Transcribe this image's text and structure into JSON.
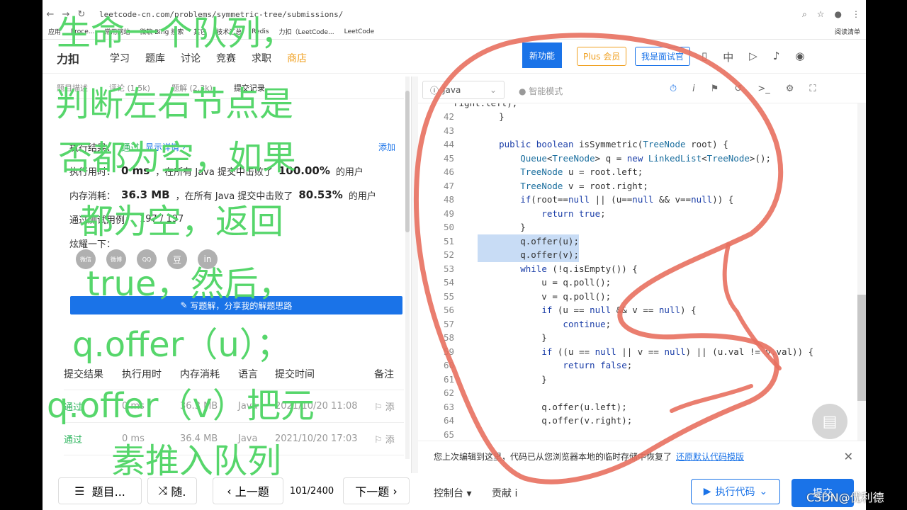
{
  "browser": {
    "url": "leetcode-cn.com/problems/symmetric-tree/submissions/",
    "bookmarks": [
      "应用",
      "Proce...",
      "常用网站",
      "微软 Bing 搜索",
      "其它",
      "技术汇总",
      "Redis",
      "力扣（LeetCode...",
      "LeetCode"
    ],
    "reader_mode": "阅读清单"
  },
  "header": {
    "logo": "力扣",
    "menu": [
      "学习",
      "题库",
      "讨论",
      "竞赛",
      "求职",
      "商店"
    ],
    "new_feature": "新功能",
    "plus": "Plus 会员",
    "interviewer": "我是面试官",
    "language": "中"
  },
  "left": {
    "tabs": [
      "题目描述",
      "评论 (1.5k)",
      "题解 (2.3k)",
      "提交记录"
    ],
    "exec_result_label": "执行结果：",
    "exec_result_value": "通过",
    "show_detail": "显示详情 ›",
    "add_note": "添加",
    "exec_time_label": "执行用时：",
    "exec_time_value": "0 ms",
    "exec_time_desc": "，在所有 Java 提交中击败了",
    "exec_time_pct": "100.00%",
    "users_label": "的用户",
    "mem_label": "内存消耗：",
    "mem_value": "36.3 MB",
    "mem_desc": "，在所有 Java 提交中击败了",
    "mem_pct": "80.53%",
    "cases_label": "通过测试用例：",
    "cases_value": "197 / 197",
    "share_label": "炫耀一下：",
    "share_icons": [
      "微信",
      "微博",
      "QQ",
      "豆",
      "in"
    ],
    "write_solution": "写题解，分享我的解题思路",
    "table_headers": [
      "提交结果",
      "执行用时",
      "内存消耗",
      "语言",
      "提交时间",
      "备注"
    ],
    "rows": [
      {
        "result": "通过",
        "time": "0 ms",
        "mem": "36.3 MB",
        "lang": "Java",
        "date": "2021/10/20 11:08",
        "note": "添"
      },
      {
        "result": "通过",
        "time": "0 ms",
        "mem": "36.4 MB",
        "lang": "Java",
        "date": "2021/10/20 17:03",
        "note": "添"
      }
    ]
  },
  "bottom_nav": {
    "list": "题目...",
    "random": "随.",
    "prev": "上一题",
    "progress": "101/2400",
    "next": "下一题"
  },
  "editor": {
    "language": "Java",
    "smart_mode": "智能模式",
    "lines": [
      {
        "n": "42",
        "t": "    }"
      },
      {
        "n": "43",
        "t": ""
      },
      {
        "n": "44",
        "t": "    public boolean isSymmetric(TreeNode root) {"
      },
      {
        "n": "45",
        "t": "        Queue<TreeNode> q = new LinkedList<TreeNode>();"
      },
      {
        "n": "46",
        "t": "        TreeNode u = root.left;"
      },
      {
        "n": "47",
        "t": "        TreeNode v = root.right;"
      },
      {
        "n": "48",
        "t": "        if(root==null || (u==null && v==null)) {"
      },
      {
        "n": "49",
        "t": "            return true;"
      },
      {
        "n": "50",
        "t": "        }"
      },
      {
        "n": "51",
        "t": "        q.offer(u);"
      },
      {
        "n": "52",
        "t": "        q.offer(v);"
      },
      {
        "n": "53",
        "t": "        while (!q.isEmpty()) {"
      },
      {
        "n": "54",
        "t": "            u = q.poll();"
      },
      {
        "n": "55",
        "t": "            v = q.poll();"
      },
      {
        "n": "56",
        "t": "            if (u == null && v == null) {"
      },
      {
        "n": "57",
        "t": "                continue;"
      },
      {
        "n": "58",
        "t": "            }"
      },
      {
        "n": "59",
        "t": "            if ((u == null || v == null) || (u.val != v.val)) {"
      },
      {
        "n": "60",
        "t": "                return false;"
      },
      {
        "n": "61",
        "t": "            }"
      },
      {
        "n": "62",
        "t": ""
      },
      {
        "n": "63",
        "t": "            q.offer(u.left);"
      },
      {
        "n": "64",
        "t": "            q.offer(v.right);"
      },
      {
        "n": "65",
        "t": ""
      }
    ],
    "partial_top_line": "right.left);",
    "highlighted_lines": [
      "51",
      "52"
    ],
    "notice": "您上次编辑到这里，代码已从您浏览器本地的临时存储中恢复了",
    "restore_link": "还原默认代码模版",
    "console": "控制台 ▾",
    "contribute": "贡献 i",
    "run_code": "执行代码",
    "submit": "提交"
  },
  "caption": {
    "lines": [
      "生命一个队列，",
      "判断左右节点是",
      "否都为空，如果",
      "都为空，返回",
      "true，然后，",
      "q.offer（u）；",
      "q.offer（v）把元",
      "素推入队列"
    ]
  },
  "watermark": "CSDN@优利德",
  "colors": {
    "caption": "#56d66b",
    "scribble": "#e8705f",
    "accent": "#1a73e8",
    "pass": "#2db55d"
  }
}
